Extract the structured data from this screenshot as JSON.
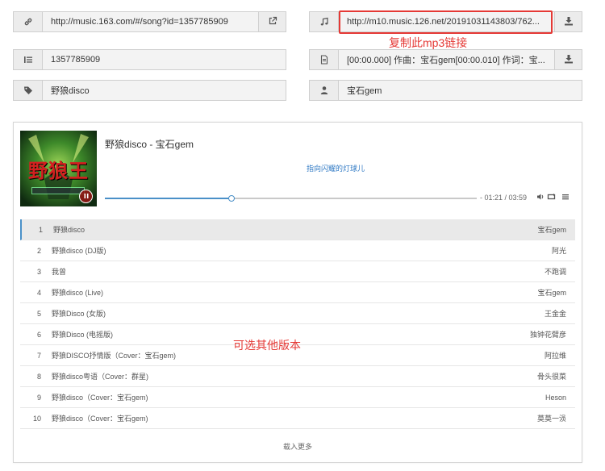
{
  "fields": {
    "song_url": "http://music.163.com/#/song?id=1357785909",
    "mp3_url": "http://m10.music.126.net/20191031143803/762...",
    "song_id": "1357785909",
    "lyric_text": "[00:00.000] 作曲：宝石gem[00:00.010] 作词：宝...",
    "song_name": "野狼disco",
    "artist": "宝石gem"
  },
  "icons": {
    "link": "link-icon",
    "external": "external-link-icon",
    "music": "music-note-icon",
    "download": "download-icon",
    "list": "list-icon",
    "file": "file-icon",
    "tag": "tag-icon",
    "user": "user-icon"
  },
  "annotations": {
    "copy_mp3": "复制此mp3链接",
    "other_versions": "可选其他版本"
  },
  "player": {
    "title": "野狼disco - 宝石gem",
    "lyric_line": "指向闪耀的灯球儿",
    "current_time": "01:21",
    "total_time": "03:59",
    "time_display": "- 01:21 / 03:59",
    "progress": 0.34,
    "cover_text": "野狼王",
    "accent_color": "#4a90c8",
    "highlight_color": "#e53935"
  },
  "playlist": [
    {
      "num": "1",
      "name": "野狼disco",
      "artist": "宝石gem"
    },
    {
      "num": "2",
      "name": "野狼disco (DJ版)",
      "artist": "阿光"
    },
    {
      "num": "3",
      "name": "我曾",
      "artist": "不跑调"
    },
    {
      "num": "4",
      "name": "野狼disco (Live)",
      "artist": "宝石gem"
    },
    {
      "num": "5",
      "name": "野狼Disco (女版)",
      "artist": "王金金"
    },
    {
      "num": "6",
      "name": "野狼Disco (电摇版)",
      "artist": "独钟花臂彦"
    },
    {
      "num": "7",
      "name": "野狼DISCO抒情版（Cover：宝石gem)",
      "artist": "阿拉维"
    },
    {
      "num": "8",
      "name": "野狼disco粤语（Cover：群星)",
      "artist": "骨头很菜"
    },
    {
      "num": "9",
      "name": "野狼disco（Cover：宝石gem)",
      "artist": "Heson"
    },
    {
      "num": "10",
      "name": "野狼disco（Cover：宝石gem)",
      "artist": "莫莫一涢"
    }
  ],
  "load_more": "载入更多"
}
